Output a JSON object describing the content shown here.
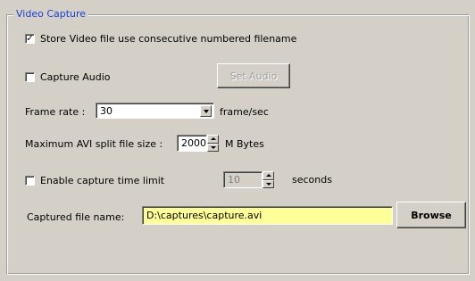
{
  "group": {
    "title": "Video Capture"
  },
  "store_numbered": {
    "label": "Store Video file use consecutive numbered filename",
    "checked": true
  },
  "capture_audio": {
    "label": "Capture Audio",
    "checked": false
  },
  "set_audio_button": {
    "label": "Set Audio",
    "enabled": false
  },
  "frame_rate": {
    "label": "Frame rate :",
    "value": "30",
    "unit": "frame/sec"
  },
  "avi_split": {
    "label": "Maximum AVI split file size :",
    "value": "2000",
    "unit": "M Bytes"
  },
  "time_limit": {
    "label": "Enable capture time limit",
    "checked": false,
    "value": "10",
    "unit": "seconds",
    "enabled": false
  },
  "captured_file": {
    "label": "Captured file name:",
    "value": "D:\\captures\\capture.avi",
    "background": "#ffff99"
  },
  "browse_button": {
    "label": "Browse"
  },
  "colors": {
    "group_title": "#1b3fd6",
    "face": "#d4d0c8"
  },
  "icons": {
    "checkmark": "checkmark-icon",
    "dropdown": "chevron-down-icon",
    "spin_up": "arrow-up-icon",
    "spin_down": "arrow-down-icon"
  }
}
